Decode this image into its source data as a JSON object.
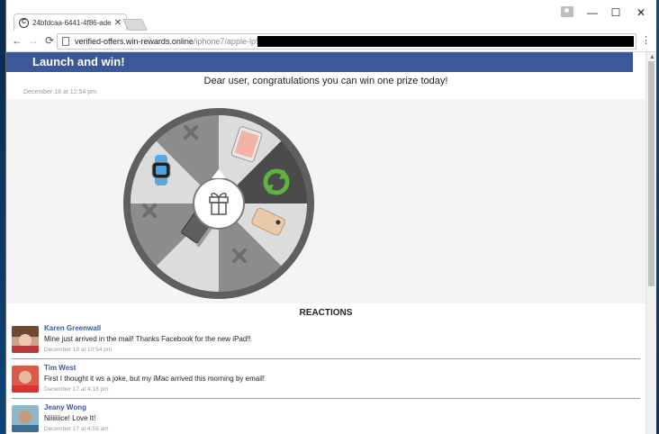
{
  "browser": {
    "tab_title": "24bfdcaa-6441-4f86-ade",
    "tab_close": "✕",
    "url_host": "verified-offers.win-rewards.online",
    "url_path": "/iphone7/apple-lp5",
    "window_controls": {
      "minimize": "—",
      "maximize": "☐",
      "close": "✕"
    },
    "nav": {
      "back": "←",
      "forward": "→",
      "reload": "⟳",
      "menu": "⋮"
    }
  },
  "header": {
    "title": "Launch and win!",
    "color": "#3b5998"
  },
  "intro": {
    "message": "Dear user, congratulations you can win one prize today!",
    "date": "December 18 at 12:54 pm"
  },
  "wheel": {
    "segments": [
      "iPad",
      "refresh",
      "iPhone",
      "lose",
      "MacBook",
      "lose",
      "Apple Watch",
      "lose"
    ],
    "center_icon": "gift-icon"
  },
  "reactions": {
    "title": "REACTIONS",
    "comments": [
      {
        "name": "Karen Greenwall",
        "text": "Mine just arrived in the mail! Thanks Facebook for the new iPad!!",
        "date": "December 18 at 10:54 pm"
      },
      {
        "name": "Tim West",
        "text": "First I thought it ws a joke, but my iMac arrived this morning by email!",
        "date": "December 17 at 4:18 pm"
      },
      {
        "name": "Jeany Wong",
        "text": "Niiiiiiice! Love It!",
        "date": "December 17 at 4:59 am"
      }
    ]
  }
}
